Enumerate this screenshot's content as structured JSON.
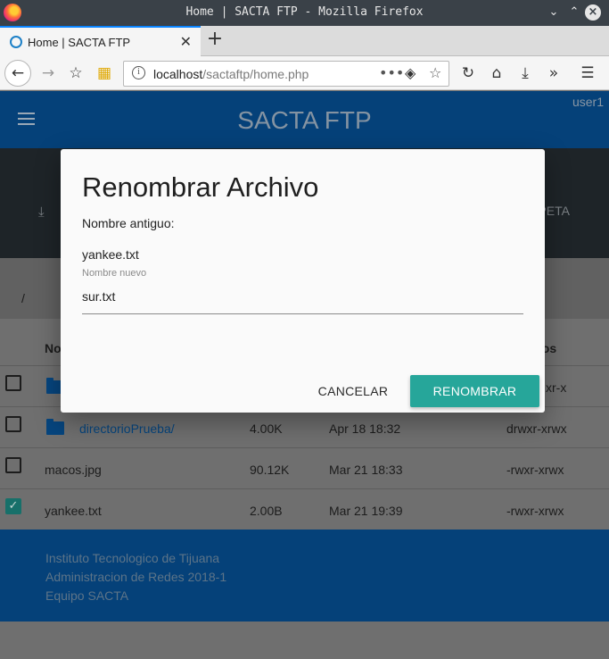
{
  "browser": {
    "window_title": "Home | SACTA FTP - Mozilla Firefox",
    "tab_title": "Home | SACTA FTP",
    "url_host": "localhost",
    "url_path": "/sactaftp/home.php"
  },
  "app": {
    "title": "SACTA FTP",
    "user": "user1",
    "folder_action_label": "PETA",
    "path": "/"
  },
  "table": {
    "headers": {
      "name": "No",
      "permissions": "sos"
    },
    "rows": [
      {
        "name": "",
        "size": "",
        "date": "",
        "perms": "xr-x",
        "type": "folder",
        "checked": false
      },
      {
        "name": "directorioPrueba/",
        "size": "4.00K",
        "date": "Apr 18 18:32",
        "perms": "drwxr-xrwx",
        "type": "folder",
        "checked": false
      },
      {
        "name": "macos.jpg",
        "size": "90.12K",
        "date": "Mar 21 18:33",
        "perms": "-rwxr-xrwx",
        "type": "file",
        "checked": false
      },
      {
        "name": "yankee.txt",
        "size": "2.00B",
        "date": "Mar 21 19:39",
        "perms": "-rwxr-xrwx",
        "type": "file",
        "checked": true
      }
    ]
  },
  "footer": {
    "line1": "Instituto Tecnologico de Tijuana",
    "line2": "Administracion de Redes 2018-1",
    "line3": "Equipo SACTA"
  },
  "dialog": {
    "title": "Renombrar Archivo",
    "old_label": "Nombre antiguo:",
    "old_name": "yankee.txt",
    "new_label": "Nombre nuevo",
    "new_value": "sur.txt",
    "cancel_label": "CANCELAR",
    "rename_label": "RENOMBRAR"
  },
  "colors": {
    "appbar": "#054179",
    "accent_button": "#26a69a",
    "checkbox_checked": "#17706a"
  }
}
